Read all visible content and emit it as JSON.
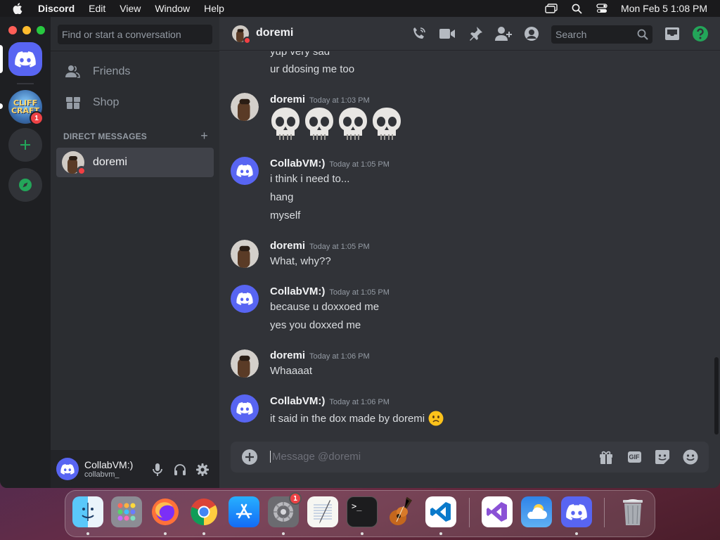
{
  "menubar": {
    "app_name": "Discord",
    "items": [
      "Edit",
      "View",
      "Window",
      "Help"
    ],
    "clock": "Mon Feb 5  1:08 PM"
  },
  "rail": {
    "server_badge": "1"
  },
  "sidebar": {
    "search_placeholder": "Find or start a conversation",
    "nav": [
      {
        "label": "Friends",
        "icon": "friends-icon"
      },
      {
        "label": "Shop",
        "icon": "shop-icon"
      }
    ],
    "dm_header": "DIRECT MESSAGES",
    "dm_add": "+",
    "dms": [
      {
        "name": "doremi",
        "status": "dnd"
      }
    ]
  },
  "user_panel": {
    "display_name": "CollabVM:)",
    "username": "collabvm_"
  },
  "channel": {
    "name": "doremi",
    "search_placeholder": "Search"
  },
  "messages": [
    {
      "id": "m0",
      "text": "yup very sad"
    },
    {
      "id": "m1",
      "text": "ur ddosing me too"
    },
    {
      "id": "m2",
      "author": "doremi",
      "timestamp": "Today at 1:03 PM",
      "content": "💀💀💀💀"
    },
    {
      "id": "m3",
      "author": "CollabVM:)",
      "timestamp": "Today at 1:05 PM",
      "lines": [
        "i think i need to...",
        "hang",
        "myself"
      ]
    },
    {
      "id": "m4",
      "author": "doremi",
      "timestamp": "Today at 1:05 PM",
      "lines": [
        "What, why??"
      ]
    },
    {
      "id": "m5",
      "author": "CollabVM:)",
      "timestamp": "Today at 1:05 PM",
      "lines": [
        "because u doxxoed me",
        "yes you doxxed me"
      ]
    },
    {
      "id": "m6",
      "author": "doremi",
      "timestamp": "Today at 1:06 PM",
      "lines": [
        "Whaaaat"
      ]
    },
    {
      "id": "m7",
      "author": "CollabVM:)",
      "timestamp": "Today at 1:06 PM",
      "lines": [
        "it said in the dox made by doremi"
      ]
    }
  ],
  "composer": {
    "placeholder": "Message @doremi",
    "gif_label": "GIF"
  },
  "dock": {
    "apps": [
      "Finder",
      "Launchpad",
      "Firefox",
      "Chrome",
      "App Store",
      "System Settings",
      "TextEdit",
      "Terminal",
      "GarageBand",
      "Visual Studio Code",
      "Visual Studio",
      "Weather",
      "Discord",
      "Trash"
    ],
    "settings_badge": "1",
    "terminal_glyph": ">_"
  },
  "colors": {
    "blurple": "#5865f2",
    "dnd_red": "#f23f43",
    "green": "#23a559",
    "bg_main": "#313338",
    "bg_sidebar": "#2b2d31",
    "bg_rail": "#1e1f22"
  }
}
